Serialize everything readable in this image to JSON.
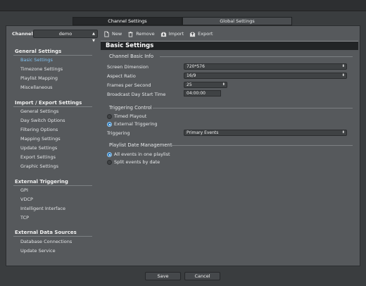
{
  "tabs": [
    {
      "label": "Channel Settings",
      "active": true
    },
    {
      "label": "Global Settings",
      "active": false
    }
  ],
  "channel": {
    "label": "Channel",
    "value": "demo"
  },
  "toolbar": {
    "new": "New",
    "remove": "Remove",
    "import": "Import",
    "export": "Export"
  },
  "sidebar": {
    "sections": [
      {
        "title": "General Settings",
        "items": [
          "Basic Settings",
          "Timezone Settings",
          "Playlist Mapping",
          "Miscellaneous"
        ]
      },
      {
        "title": "Import / Export Settings",
        "items": [
          "General Settings",
          "Day Switch Options",
          "Filtering Options",
          "Mapping Settings",
          "Update Settings",
          "Export Settings",
          "Graphic Settings"
        ]
      },
      {
        "title": "External Triggering",
        "items": [
          "GPI",
          "VDCP",
          "Intelligent Interface",
          "TCP"
        ]
      },
      {
        "title": "External Data Sources",
        "items": [
          "Database Connections",
          "Update Service"
        ]
      }
    ],
    "active_item": "Basic Settings"
  },
  "main": {
    "title": "Basic Settings",
    "channel_info": {
      "title": "Channel Basic Info",
      "screen_dimension": {
        "label": "Screen Dimension",
        "value": "720*576"
      },
      "aspect_ratio": {
        "label": "Aspect Ratio",
        "value": "16/9"
      },
      "fps": {
        "label": "Frames per Second",
        "value": "25"
      },
      "day_start": {
        "label": "Broadcast Day Start Time",
        "value": "04:00:00"
      }
    },
    "triggering": {
      "title": "Triggering Control",
      "options": [
        "Timed Playout",
        "External Triggering"
      ],
      "selected": "External Triggering",
      "trigger_label": "Triggering",
      "trigger_value": "Primary Events"
    },
    "playlist_date": {
      "title": "Playlist Date Management",
      "options": [
        "All events in one playlist",
        "Split events by date"
      ],
      "selected": "All events in one playlist"
    }
  },
  "footer": {
    "save": "Save",
    "cancel": "Cancel"
  },
  "colors": {
    "accent": "#2f7fc0",
    "active_link": "#7fc0f0"
  }
}
